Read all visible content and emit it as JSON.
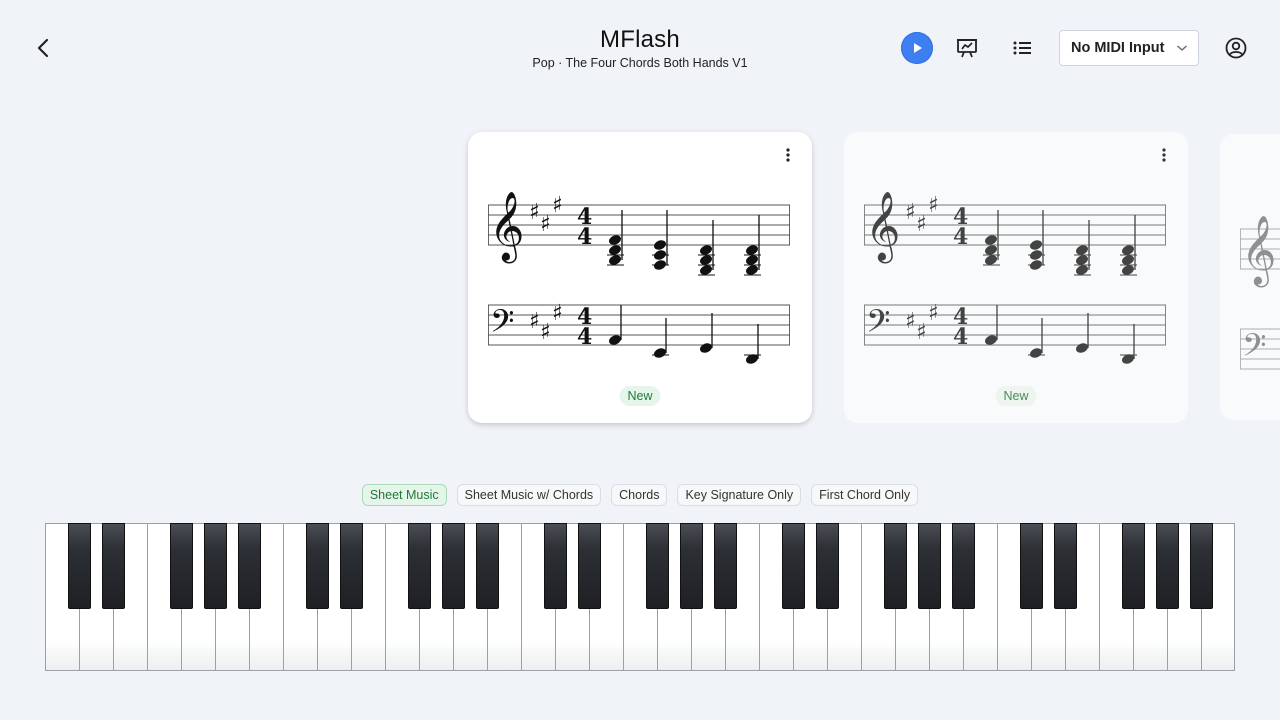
{
  "header": {
    "title": "MFlash",
    "subtitle": "Pop · The Four Chords Both Hands V1",
    "midi_select": "No MIDI Input"
  },
  "accent_color": "#3d7ef0",
  "icons": {
    "back": "chevron-left-icon",
    "play": "play-icon",
    "present": "presentation-chart-icon",
    "list": "list-icon",
    "dropdown": "chevron-down-icon",
    "account": "user-circle-icon",
    "card_menu": "kebab-menu-icon"
  },
  "cards": [
    {
      "badge": "New"
    },
    {
      "badge": "New"
    }
  ],
  "tabs": [
    {
      "label": "Sheet Music",
      "active": true
    },
    {
      "label": "Sheet Music w/ Chords",
      "active": false
    },
    {
      "label": "Chords",
      "active": false
    },
    {
      "label": "Key Signature Only",
      "active": false
    },
    {
      "label": "First Chord Only",
      "active": false
    }
  ],
  "piano": {
    "white_keys": 35
  }
}
